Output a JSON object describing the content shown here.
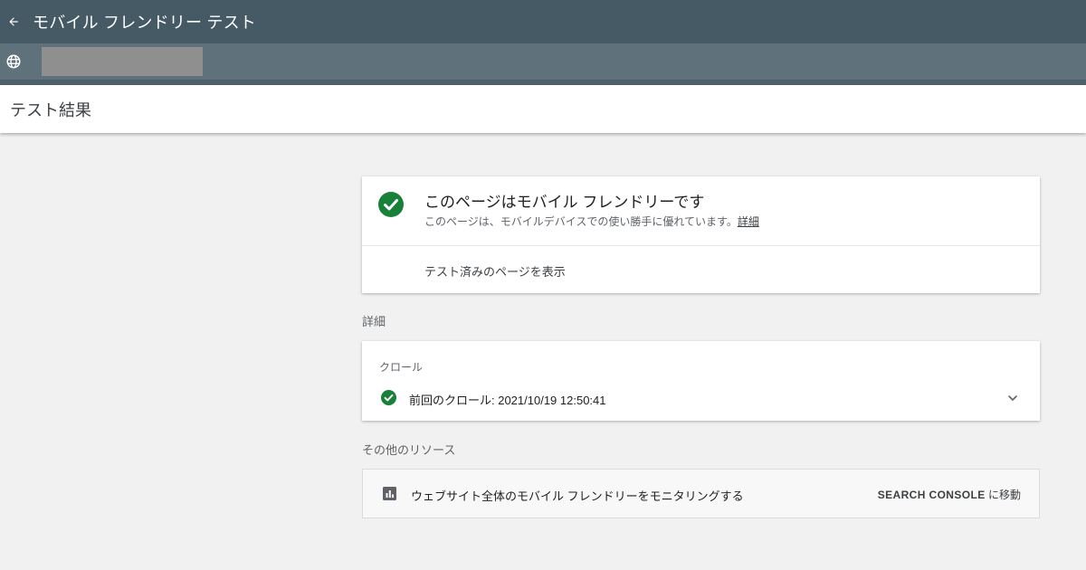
{
  "header": {
    "back_icon": "arrow-left-icon",
    "title": "モバイル フレンドリー テスト"
  },
  "url_bar": {
    "icon": "globe-icon",
    "value": ""
  },
  "results": {
    "title": "テスト結果"
  },
  "summary": {
    "icon": "check-circle-icon",
    "status_color": "#188038",
    "title": "このページはモバイル フレンドリーです",
    "subtitle": "このページは、モバイルデバイスでの使い勝手に優れています。",
    "details_link": "詳細",
    "view_tested_page": "テスト済みのページを表示"
  },
  "details": {
    "label": "詳細",
    "crawl": {
      "label": "クロール",
      "status_icon": "check-circle-icon",
      "text": "前回のクロール: 2021/10/19 12:50:41",
      "expand_icon": "chevron-down-icon"
    }
  },
  "other_resources": {
    "label": "その他のリソース",
    "item": {
      "icon": "bar-chart-icon",
      "text": "ウェブサイト全体のモバイル フレンドリーをモニタリングする",
      "link_strong": "SEARCH CONSOLE",
      "link_suffix": " に移動"
    }
  }
}
